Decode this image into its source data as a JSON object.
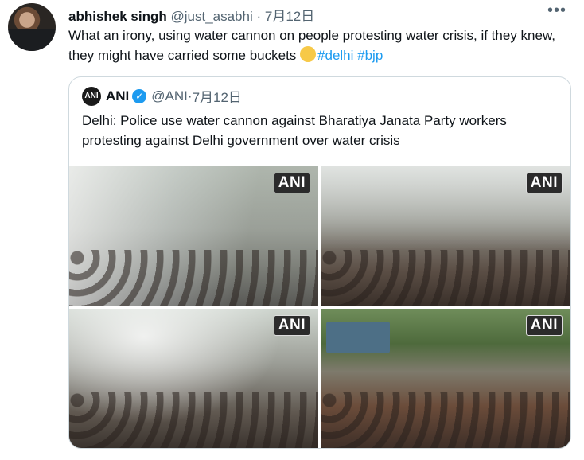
{
  "tweet": {
    "display_name": "abhishek singh",
    "handle": "@just_asabhi",
    "separator": "·",
    "date": "7月12日",
    "more_icon": "more-horizontal-icon",
    "text_main": "What an irony, using water cannon on people protesting water crisis, if they knew, they might have carried some buckets ",
    "hashtags": [
      "#delhi",
      "#bjp"
    ]
  },
  "quoted": {
    "logo_text": "ANI",
    "display_name": "ANI",
    "handle": "@ANI",
    "separator": "·",
    "date": "7月12日",
    "text": "Delhi: Police use water cannon against Bharatiya Janata Party workers protesting against Delhi government over water crisis",
    "photos": [
      {
        "watermark": "ANI"
      },
      {
        "watermark": "ANI"
      },
      {
        "watermark": "ANI"
      },
      {
        "watermark": "ANI"
      }
    ]
  },
  "colors": {
    "link": "#1d9bf0",
    "secondary_text": "#536471",
    "border": "#cfd9de"
  }
}
